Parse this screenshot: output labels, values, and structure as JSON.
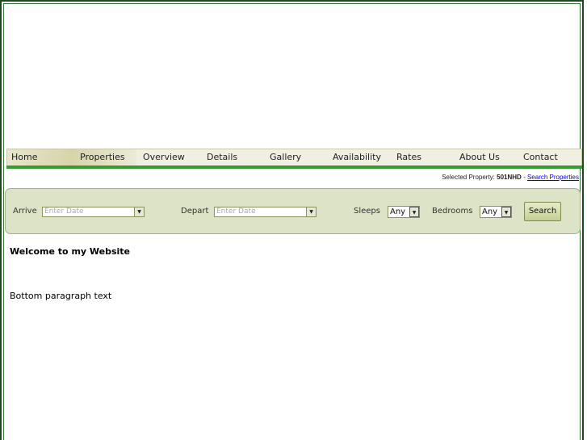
{
  "nav": {
    "items": [
      {
        "label": "Home"
      },
      {
        "label": "Properties"
      },
      {
        "label": "Overview"
      },
      {
        "label": "Details"
      },
      {
        "label": "Gallery"
      },
      {
        "label": "Availability"
      },
      {
        "label": "Rates"
      },
      {
        "label": "About Us"
      },
      {
        "label": "Contact"
      }
    ]
  },
  "property": {
    "prefix": "Selected Property:",
    "code": "501NHD",
    "separator": "-",
    "search_link": "Search Properties"
  },
  "search": {
    "arrive_label": "Arrive",
    "arrive_placeholder": "Enter Date",
    "depart_label": "Depart",
    "depart_placeholder": "Enter Date",
    "sleeps_label": "Sleeps",
    "sleeps_value": "Any",
    "bedrooms_label": "Bedrooms",
    "bedrooms_value": "Any",
    "button_label": "Search",
    "dropdown_glyph": "▼"
  },
  "content": {
    "welcome": "Welcome to my Website",
    "bottom": "Bottom paragraph text"
  },
  "colors": {
    "frame": "#1c4a1c",
    "nav_accent": "#2fa02f",
    "panel_bg": "#dde3c6",
    "link": "#0000ee"
  }
}
